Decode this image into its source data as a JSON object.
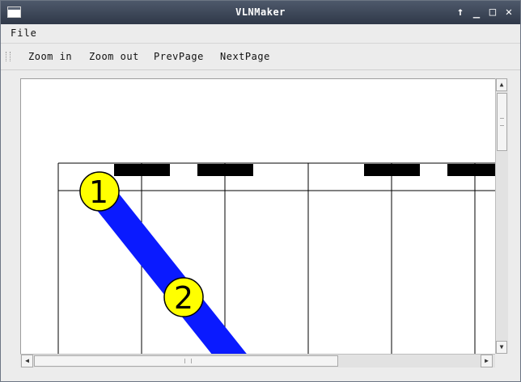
{
  "window": {
    "title": "VLNMaker",
    "controls": [
      "↑",
      "_",
      "□",
      "✕"
    ]
  },
  "menu": {
    "file": "File"
  },
  "toolbar": {
    "zoom_in": "Zoom in",
    "zoom_out": "Zoom out",
    "prev_page": "PrevPage",
    "next_page": "NextPage"
  },
  "canvas": {
    "markers": [
      {
        "label": "1"
      },
      {
        "label": "2"
      }
    ],
    "colors": {
      "path": "#0a1aff",
      "marker_fill": "#ffff00",
      "grid": "#000000",
      "block": "#000000"
    }
  },
  "scrollbars": {
    "up_arrow": "▲",
    "down_arrow": "▼",
    "left_arrow": "◀",
    "right_arrow": "▶"
  }
}
